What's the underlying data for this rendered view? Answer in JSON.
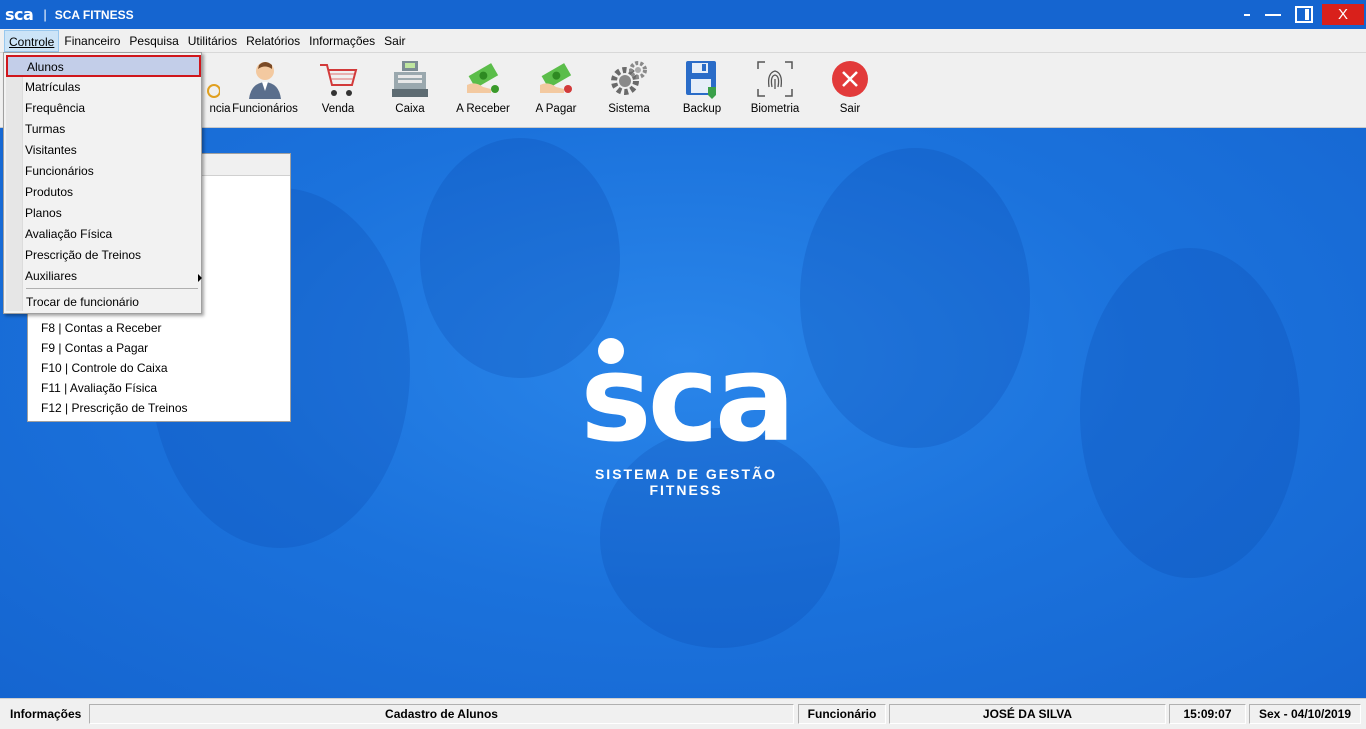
{
  "titlebar": {
    "logo": "sca",
    "separator": "|",
    "title": "SCA FITNESS",
    "close_label": "X"
  },
  "menubar": [
    {
      "label": "Controle",
      "active": true
    },
    {
      "label": "Financeiro"
    },
    {
      "label": "Pesquisa"
    },
    {
      "label": "Utilitários"
    },
    {
      "label": "Relatórios"
    },
    {
      "label": "Informações"
    },
    {
      "label": "Sair"
    }
  ],
  "toolbar": {
    "partial_label": "ncia",
    "funcionarios": "Funcionários",
    "venda": "Venda",
    "caixa": "Caixa",
    "a_receber": "A Receber",
    "a_pagar": "A Pagar",
    "sistema": "Sistema",
    "backup": "Backup",
    "biometria": "Biometria",
    "sair": "Sair"
  },
  "dropdown": {
    "items": [
      "Alunos",
      "Matrículas",
      "Frequência",
      "Turmas",
      "Visitantes",
      "Funcionários",
      "Produtos",
      "Planos",
      "Avaliação Física",
      "Prescrição de Treinos",
      "Auxiliares"
    ],
    "bottom_item": "Trocar de funcionário"
  },
  "shortcuts": [
    "F8 | Contas a Receber",
    "F9 | Contas a Pagar",
    "F10 | Controle do Caixa",
    "F11 | Avaliação Física",
    "F12 | Prescrição de Treinos"
  ],
  "brand": {
    "logo": "sca",
    "subtitle": "SISTEMA DE GESTÃO FITNESS"
  },
  "statusbar": {
    "info": "Informações",
    "action": "Cadastro de Alunos",
    "role": "Funcionário",
    "user": "JOSÉ DA SILVA",
    "time": "15:09:07",
    "date": "Sex - 04/10/2019"
  },
  "colors": {
    "titlebar": "#1565d0",
    "close": "#d9201b",
    "highlight_border": "#d0161c",
    "background": "#1a6fd9"
  }
}
